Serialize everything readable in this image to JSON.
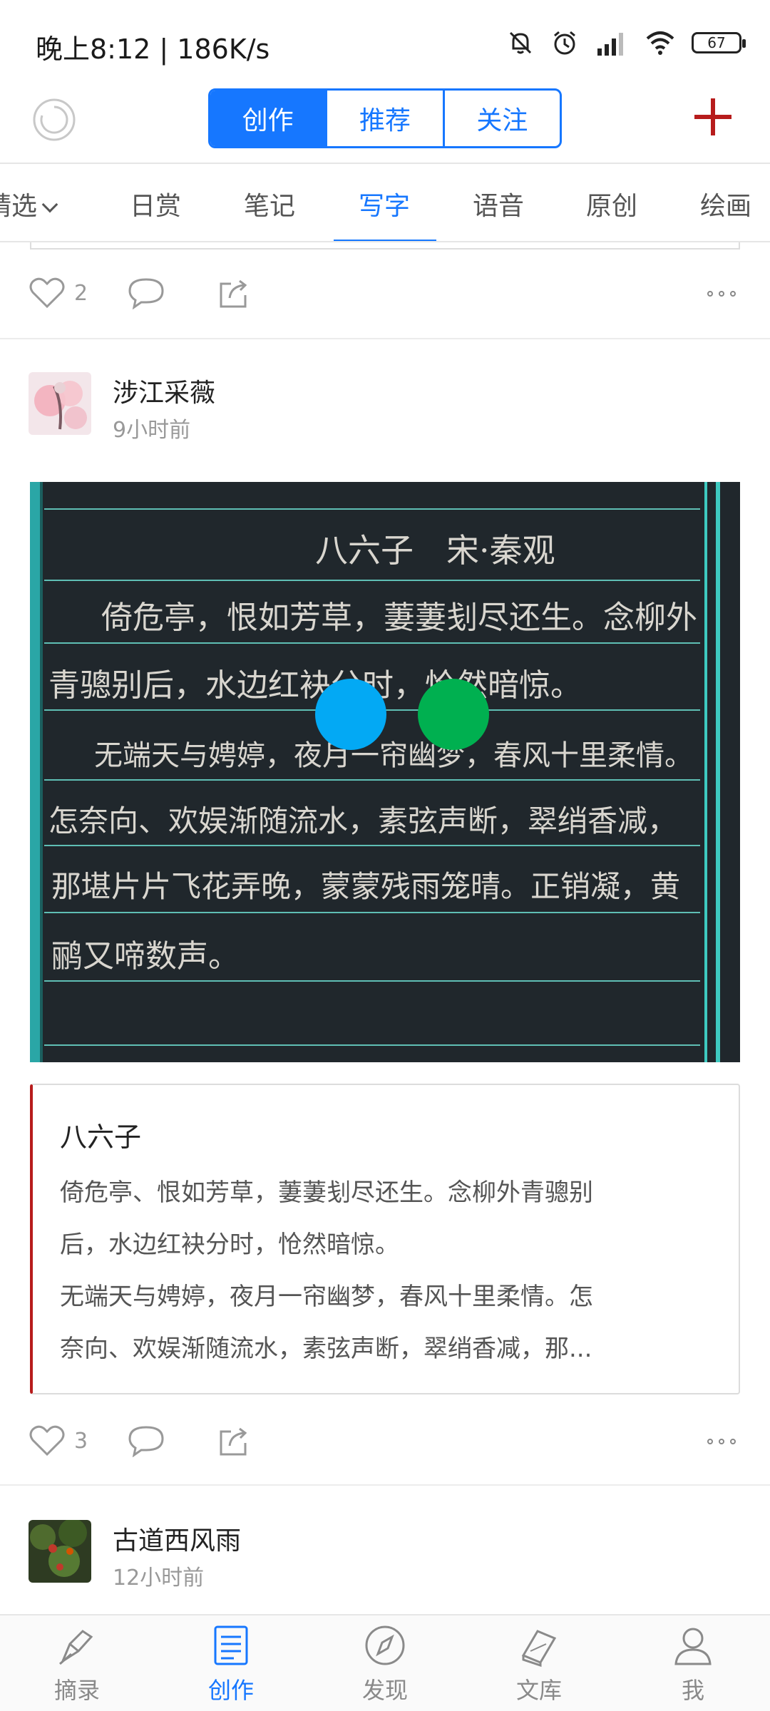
{
  "status": {
    "time": "晚上8:12 | 186K/s",
    "battery": "67"
  },
  "header": {
    "tabs": [
      {
        "label": "创作",
        "active": true
      },
      {
        "label": "推荐",
        "active": false
      },
      {
        "label": "关注",
        "active": false
      }
    ]
  },
  "categories": [
    "精选",
    "日赏",
    "笔记",
    "写字",
    "语音",
    "原创",
    "绘画"
  ],
  "active_category": "写字",
  "feed": {
    "prev_post": {
      "likes": "2"
    },
    "post": {
      "author": "涉江采薇",
      "time": "9小时前",
      "title": "八六子",
      "lines": [
        "倚危亭、恨如芳草，萋萋刬尽还生。念柳外青骢别",
        "后，水边红袂分时，怆然暗惊。",
        "无端天与娉婷，夜月一帘幽梦，春风十里柔情。怎",
        "奈向、欢娱渐随流水，素弦声断，翠绡香减，那..."
      ],
      "likes": "3"
    },
    "next_post": {
      "author": "古道西风雨",
      "time": "12小时前"
    }
  },
  "handwriting": {
    "lines": [
      "八六子　宋·秦观",
      "倚危亭，恨如芳草，萋萋刬尽还生。念柳外",
      "青骢别后，水边红袂分时，怆然暗惊。",
      "无端天与娉婷，夜月一帘幽梦，春风十里柔情。",
      "怎奈向、欢娱渐随流水，素弦声断，翠绡香减，",
      "那堪片片飞花弄晚，蒙蒙残雨笼晴。正销凝，黄",
      "鹂又啼数声。"
    ]
  },
  "bottom_nav": [
    {
      "label": "摘录",
      "icon": "quill-icon",
      "active": false
    },
    {
      "label": "创作",
      "icon": "document-icon",
      "active": true
    },
    {
      "label": "发现",
      "icon": "compass-icon",
      "active": false
    },
    {
      "label": "文库",
      "icon": "books-icon",
      "active": false
    },
    {
      "label": "我",
      "icon": "person-icon",
      "active": false
    }
  ],
  "colors": {
    "accent": "#1677ff",
    "brand_red": "#b71c1c",
    "touch_blue": "#03a9f4",
    "touch_green": "#00b050"
  }
}
